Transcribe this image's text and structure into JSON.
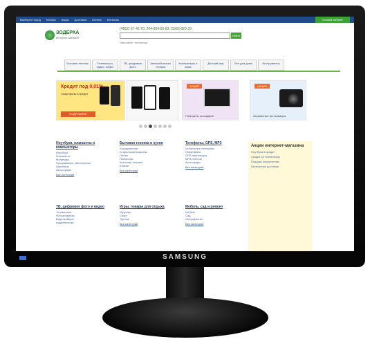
{
  "brand": "SAMSUNG",
  "site": {
    "topbar": {
      "left": "Выберите город",
      "links": [
        "Москва",
        "Акции",
        "Доставка",
        "Оплата",
        "Контакты"
      ],
      "green_label": "Личный кабинет"
    },
    "logo": {
      "name": "ЗОДЕРКА",
      "tagline": "интернет-магазин"
    },
    "phones": "(4852) 67-42-70, 264-804-66-83, 25/82-820-33",
    "search": {
      "placeholder": "",
      "button": "Найти",
      "hint": "Например: телевизор"
    },
    "nav": [
      "Бытовая техника",
      "Телевизоры, аудио, видео",
      "ТВ, цифровые фото",
      "Автомобильная техника",
      "Компьютеры и офис",
      "Детский мир",
      "Все для дома",
      "Инструменты"
    ],
    "banners": [
      {
        "title": "Кредит под 0,01%",
        "line": "Смартфоны в кредит",
        "button": "ПОДРОБНЕЕ"
      },
      {
        "promo": "",
        "caption": ""
      },
      {
        "promo": "АКЦИЯ",
        "caption": "Планшеты со скидкой"
      },
      {
        "promo": "АКЦИЯ",
        "caption": "Зеркальные фотокамеры"
      }
    ],
    "columns": [
      {
        "heading": "Ноутбуки, планшеты и компьютеры",
        "items": [
          "Ноутбуки",
          "Планшеты",
          "Мониторы",
          "Программное обеспечение",
          "Принтеры",
          "Аксессуары"
        ],
        "more": "Все категории"
      },
      {
        "heading": "Бытовая техника и кухня",
        "items": [
          "Холодильники",
          "Стиральные машины",
          "Плиты",
          "Пылесосы",
          "Кухонная техника",
          "Климат"
        ],
        "more": "Все категории"
      },
      {
        "heading": "Телефоны, GPS, MP3",
        "items": [
          "Мобильные телефоны",
          "Смартфоны",
          "GPS-навигаторы",
          "MP3-плееры",
          "Аксессуары"
        ],
        "more": "Все категории"
      },
      {
        "heading": "ТВ, цифровое фото и видео",
        "items": [
          "Телевизоры",
          "Фотоаппараты",
          "Видеокамеры",
          "Аудиотехника"
        ],
        "more": ""
      },
      {
        "heading": "Игры, товары для отдыха",
        "items": [
          "Игрушки",
          "Спорт",
          "Туризм"
        ],
        "more": "Все категории"
      },
      {
        "heading": "Мебель, сад и ремонт",
        "items": [
          "Мебель",
          "Сад",
          "Инструменты"
        ],
        "more": "Все категории"
      }
    ],
    "aside": {
      "heading": "Акции интернет-магазина",
      "lines": [
        "Ноутбуки в кредит",
        "Скидки на телевизоры",
        "Подарки покупателям",
        "Бесплатная доставка"
      ]
    }
  }
}
